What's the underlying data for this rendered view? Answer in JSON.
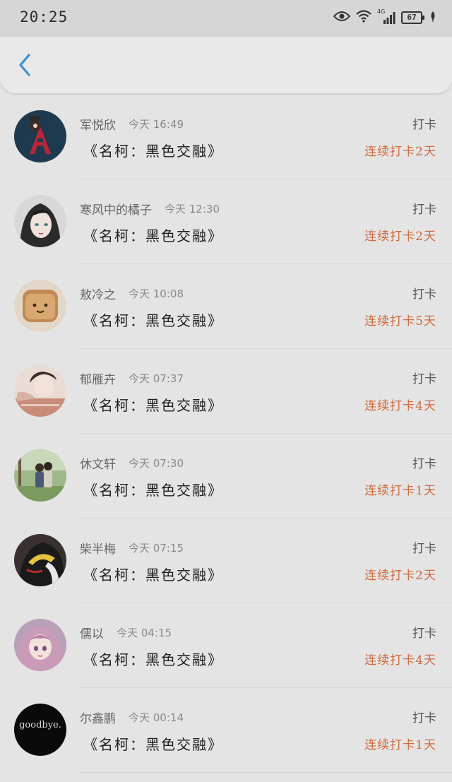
{
  "status_bar": {
    "time": "20:25",
    "network": "4G",
    "battery": "67",
    "icons": [
      "eye-icon",
      "wifi-icon",
      "signal-icon",
      "battery-icon",
      "leaf-icon"
    ]
  },
  "header": {
    "back_icon": "chevron-left-icon",
    "accent_color": "#3b8fd6"
  },
  "colors": {
    "streak": "#cf6a3d",
    "name": "#666666",
    "title": "#1e1e1e"
  },
  "list": [
    {
      "name": "军悦欣",
      "time": "今天 16:49",
      "action": "打卡",
      "title": "《名柯：黑色交融》",
      "streak": "连续打卡2天"
    },
    {
      "name": "寒风中的橘子",
      "time": "今天 12:30",
      "action": "打卡",
      "title": "《名柯：黑色交融》",
      "streak": "连续打卡2天"
    },
    {
      "name": "敖冷之",
      "time": "今天 10:08",
      "action": "打卡",
      "title": "《名柯：黑色交融》",
      "streak": "连续打卡5天"
    },
    {
      "name": "郁雁卉",
      "time": "今天 07:37",
      "action": "打卡",
      "title": "《名柯：黑色交融》",
      "streak": "连续打卡4天"
    },
    {
      "name": "休文轩",
      "time": "今天 07:30",
      "action": "打卡",
      "title": "《名柯：黑色交融》",
      "streak": "连续打卡1天"
    },
    {
      "name": "柴半梅",
      "time": "今天 07:15",
      "action": "打卡",
      "title": "《名柯：黑色交融》",
      "streak": "连续打卡2天"
    },
    {
      "name": "儒以",
      "time": "今天 04:15",
      "action": "打卡",
      "title": "《名柯：黑色交融》",
      "streak": "连续打卡4天"
    },
    {
      "name": "尔鑫鹏",
      "time": "今天 00:14",
      "action": "打卡",
      "title": "《名柯：黑色交融》",
      "streak": "连续打卡1天"
    }
  ],
  "avatars": {
    "goodbye_text": "goodbye."
  }
}
